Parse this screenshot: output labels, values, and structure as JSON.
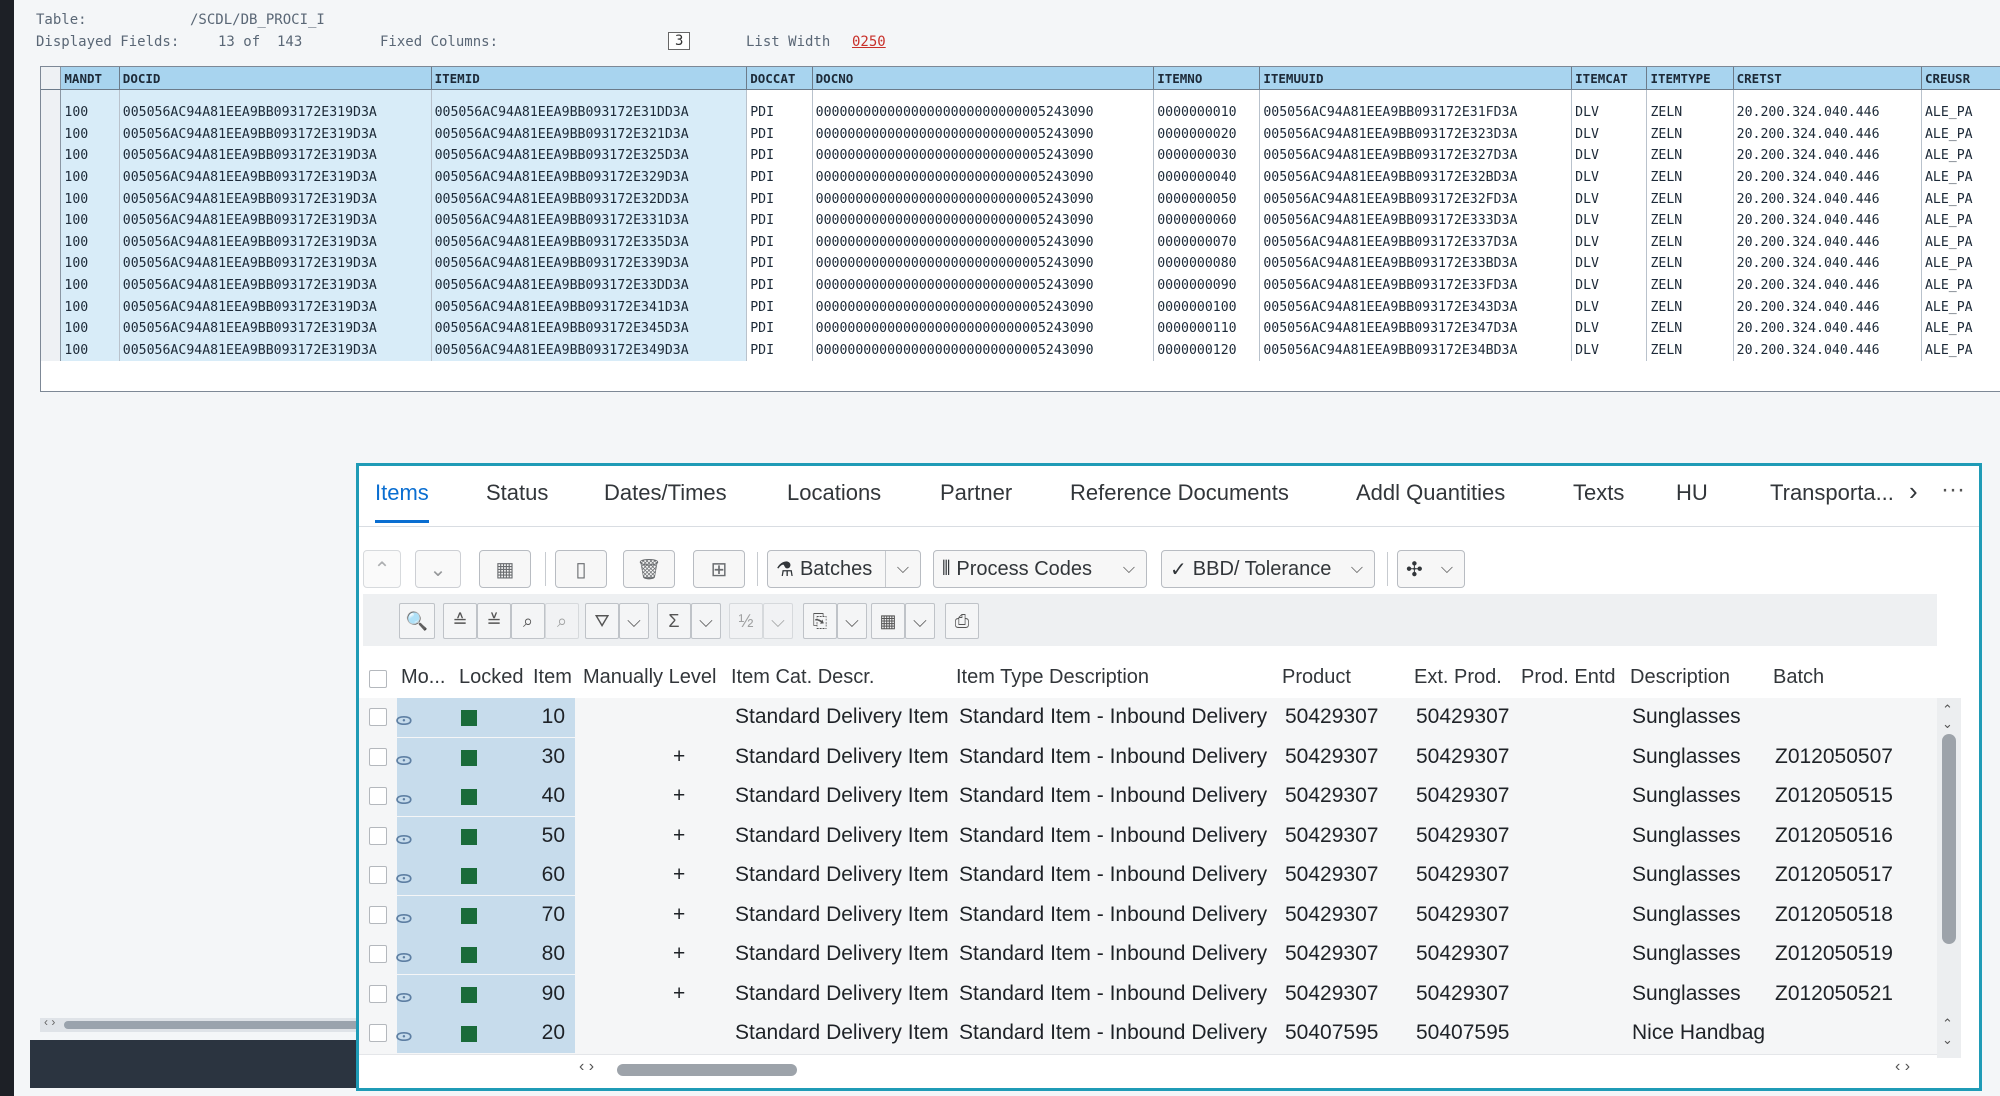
{
  "se16": {
    "table_label": "Table:",
    "table_value": "/SCDL/DB_PROCI_I",
    "displayed_label": "Displayed Fields:",
    "displayed_value": "13 of  143",
    "fixed_label": "Fixed Columns:",
    "fixed_value": "3",
    "list_width_label": "List Width",
    "list_width_value": "0250",
    "columns": [
      "MANDT",
      "DOCID",
      "ITEMID",
      "DOCCAT",
      "DOCNO",
      "ITEMNO",
      "ITEMUUID",
      "ITEMCAT",
      "ITEMTYPE",
      "CRETST",
      "CREUSR"
    ],
    "rows": [
      [
        "100",
        "005056AC94A81EEA9BB093172E319D3A",
        "005056AC94A81EEA9BB093172E31DD3A",
        "PDI",
        "00000000000000000000000000005243090",
        "0000000010",
        "005056AC94A81EEA9BB093172E31FD3A",
        "DLV",
        "ZELN",
        "20.200.324.040.446",
        "ALE_PA"
      ],
      [
        "100",
        "005056AC94A81EEA9BB093172E319D3A",
        "005056AC94A81EEA9BB093172E321D3A",
        "PDI",
        "00000000000000000000000000005243090",
        "0000000020",
        "005056AC94A81EEA9BB093172E323D3A",
        "DLV",
        "ZELN",
        "20.200.324.040.446",
        "ALE_PA"
      ],
      [
        "100",
        "005056AC94A81EEA9BB093172E319D3A",
        "005056AC94A81EEA9BB093172E325D3A",
        "PDI",
        "00000000000000000000000000005243090",
        "0000000030",
        "005056AC94A81EEA9BB093172E327D3A",
        "DLV",
        "ZELN",
        "20.200.324.040.446",
        "ALE_PA"
      ],
      [
        "100",
        "005056AC94A81EEA9BB093172E319D3A",
        "005056AC94A81EEA9BB093172E329D3A",
        "PDI",
        "00000000000000000000000000005243090",
        "0000000040",
        "005056AC94A81EEA9BB093172E32BD3A",
        "DLV",
        "ZELN",
        "20.200.324.040.446",
        "ALE_PA"
      ],
      [
        "100",
        "005056AC94A81EEA9BB093172E319D3A",
        "005056AC94A81EEA9BB093172E32DD3A",
        "PDI",
        "00000000000000000000000000005243090",
        "0000000050",
        "005056AC94A81EEA9BB093172E32FD3A",
        "DLV",
        "ZELN",
        "20.200.324.040.446",
        "ALE_PA"
      ],
      [
        "100",
        "005056AC94A81EEA9BB093172E319D3A",
        "005056AC94A81EEA9BB093172E331D3A",
        "PDI",
        "00000000000000000000000000005243090",
        "0000000060",
        "005056AC94A81EEA9BB093172E333D3A",
        "DLV",
        "ZELN",
        "20.200.324.040.446",
        "ALE_PA"
      ],
      [
        "100",
        "005056AC94A81EEA9BB093172E319D3A",
        "005056AC94A81EEA9BB093172E335D3A",
        "PDI",
        "00000000000000000000000000005243090",
        "0000000070",
        "005056AC94A81EEA9BB093172E337D3A",
        "DLV",
        "ZELN",
        "20.200.324.040.446",
        "ALE_PA"
      ],
      [
        "100",
        "005056AC94A81EEA9BB093172E319D3A",
        "005056AC94A81EEA9BB093172E339D3A",
        "PDI",
        "00000000000000000000000000005243090",
        "0000000080",
        "005056AC94A81EEA9BB093172E33BD3A",
        "DLV",
        "ZELN",
        "20.200.324.040.446",
        "ALE_PA"
      ],
      [
        "100",
        "005056AC94A81EEA9BB093172E319D3A",
        "005056AC94A81EEA9BB093172E33DD3A",
        "PDI",
        "00000000000000000000000000005243090",
        "0000000090",
        "005056AC94A81EEA9BB093172E33FD3A",
        "DLV",
        "ZELN",
        "20.200.324.040.446",
        "ALE_PA"
      ],
      [
        "100",
        "005056AC94A81EEA9BB093172E319D3A",
        "005056AC94A81EEA9BB093172E341D3A",
        "PDI",
        "00000000000000000000000000005243090",
        "0000000100",
        "005056AC94A81EEA9BB093172E343D3A",
        "DLV",
        "ZELN",
        "20.200.324.040.446",
        "ALE_PA"
      ],
      [
        "100",
        "005056AC94A81EEA9BB093172E319D3A",
        "005056AC94A81EEA9BB093172E345D3A",
        "PDI",
        "00000000000000000000000000005243090",
        "0000000110",
        "005056AC94A81EEA9BB093172E347D3A",
        "DLV",
        "ZELN",
        "20.200.324.040.446",
        "ALE_PA"
      ],
      [
        "100",
        "005056AC94A81EEA9BB093172E319D3A",
        "005056AC94A81EEA9BB093172E349D3A",
        "PDI",
        "00000000000000000000000000005243090",
        "0000000120",
        "005056AC94A81EEA9BB093172E34BD3A",
        "DLV",
        "ZELN",
        "20.200.324.040.446",
        "ALE_PA"
      ]
    ]
  },
  "tabs": [
    "Items",
    "Status",
    "Dates/Times",
    "Locations",
    "Partner",
    "Reference Documents",
    "Addl Quantities",
    "Texts",
    "HU",
    "Transporta..."
  ],
  "toolbar": {
    "batches": "Batches",
    "process_codes": "Process Codes",
    "bbd_tolerance": "BBD/ Tolerance"
  },
  "grid": {
    "columns": [
      "Mo...",
      "Locked",
      "Item",
      "Manually Level",
      "Item Cat. Descr.",
      "Item Type Description",
      "Product",
      "Ext. Prod.",
      "Prod. Entd",
      "Description",
      "Batch"
    ],
    "rows": [
      {
        "item": "10",
        "manual": "",
        "itemcat": "Standard Delivery Item",
        "itemtype": "Standard Item - Inbound Delivery",
        "product": "50429307",
        "extprod": "50429307",
        "desc": "Sunglasses",
        "batch": ""
      },
      {
        "item": "30",
        "manual": "+",
        "itemcat": "Standard Delivery Item",
        "itemtype": "Standard Item - Inbound Delivery",
        "product": "50429307",
        "extprod": "50429307",
        "desc": "Sunglasses",
        "batch": "Z012050507"
      },
      {
        "item": "40",
        "manual": "+",
        "itemcat": "Standard Delivery Item",
        "itemtype": "Standard Item - Inbound Delivery",
        "product": "50429307",
        "extprod": "50429307",
        "desc": "Sunglasses",
        "batch": "Z012050515"
      },
      {
        "item": "50",
        "manual": "+",
        "itemcat": "Standard Delivery Item",
        "itemtype": "Standard Item - Inbound Delivery",
        "product": "50429307",
        "extprod": "50429307",
        "desc": "Sunglasses",
        "batch": "Z012050516"
      },
      {
        "item": "60",
        "manual": "+",
        "itemcat": "Standard Delivery Item",
        "itemtype": "Standard Item - Inbound Delivery",
        "product": "50429307",
        "extprod": "50429307",
        "desc": "Sunglasses",
        "batch": "Z012050517"
      },
      {
        "item": "70",
        "manual": "+",
        "itemcat": "Standard Delivery Item",
        "itemtype": "Standard Item - Inbound Delivery",
        "product": "50429307",
        "extprod": "50429307",
        "desc": "Sunglasses",
        "batch": "Z012050518"
      },
      {
        "item": "80",
        "manual": "+",
        "itemcat": "Standard Delivery Item",
        "itemtype": "Standard Item - Inbound Delivery",
        "product": "50429307",
        "extprod": "50429307",
        "desc": "Sunglasses",
        "batch": "Z012050519"
      },
      {
        "item": "90",
        "manual": "+",
        "itemcat": "Standard Delivery Item",
        "itemtype": "Standard Item - Inbound Delivery",
        "product": "50429307",
        "extprod": "50429307",
        "desc": "Sunglasses",
        "batch": "Z012050521"
      },
      {
        "item": "20",
        "manual": "",
        "itemcat": "Standard Delivery Item",
        "itemtype": "Standard Item - Inbound Delivery",
        "product": "50407595",
        "extprod": "50407595",
        "desc": "Nice Handbag",
        "batch": ""
      }
    ]
  },
  "colors": {
    "accent": "#0a6ed1",
    "frame": "#1f9bb6",
    "header_blue": "#a8d4ef",
    "locked_green": "#1a6b3a"
  }
}
